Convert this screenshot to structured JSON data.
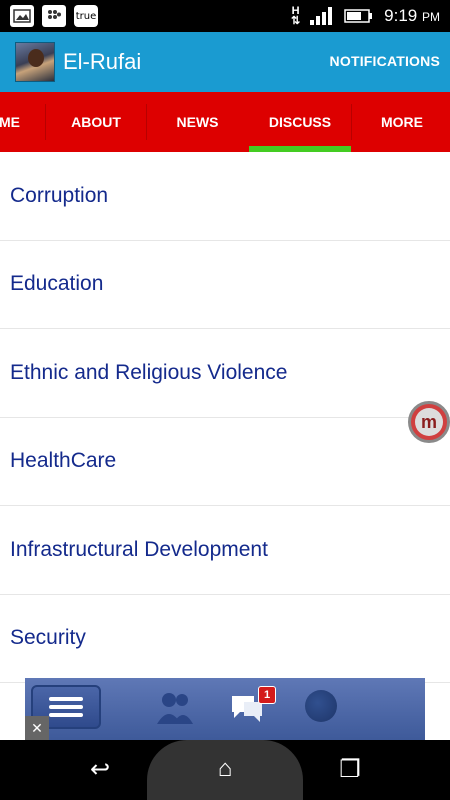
{
  "status_bar": {
    "left_icons": [
      "gallery-icon",
      "bbm-icon",
      "true-app-icon"
    ],
    "true_label": "true",
    "network_label": "H",
    "time": "9:19",
    "ampm": "PM"
  },
  "app_bar": {
    "title": "El-Rufai",
    "notifications_label": "NOTIFICATIONS",
    "background": "#1a9bd1"
  },
  "tabs": {
    "background": "#dd0000",
    "active_indicator": "#44cc22",
    "items": [
      {
        "label": "ME",
        "active": false
      },
      {
        "label": "ABOUT",
        "active": false
      },
      {
        "label": "NEWS",
        "active": false
      },
      {
        "label": "DISCUSS",
        "active": true
      },
      {
        "label": "MORE",
        "active": false
      }
    ]
  },
  "topics": [
    {
      "label": "Corruption"
    },
    {
      "label": "Education"
    },
    {
      "label": "Ethnic and Religious Violence"
    },
    {
      "label": "HealthCare"
    },
    {
      "label": "Infrastructural Development"
    },
    {
      "label": "Security"
    }
  ],
  "floating_badge": {
    "letter": "m"
  },
  "ad_banner": {
    "icons": [
      "menu-icon",
      "friends-icon",
      "messages-icon",
      "globe-icon"
    ],
    "message_count": "1",
    "close_symbol": "✕"
  },
  "nav_bar": {
    "back_symbol": "↩",
    "home_symbol": "⌂",
    "recents_symbol": "❐"
  }
}
